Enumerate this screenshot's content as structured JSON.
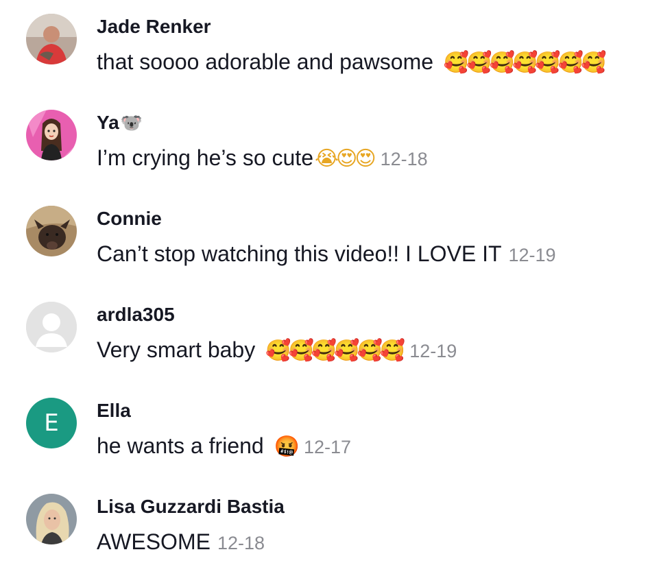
{
  "comments": [
    {
      "username": "Jade Renker",
      "name_emoji": "",
      "text": "that soooo adorable and pawsome",
      "emojis": "🥰🥰🥰🥰🥰🥰🥰",
      "date": "",
      "avatar": "photo-woman-red-shirt"
    },
    {
      "username": "Ya",
      "name_emoji": "🐨",
      "text": "I’m crying he’s so cute",
      "emojis": "😭😍😍",
      "date": "12-18",
      "avatar": "cartoon-girl-pink-background"
    },
    {
      "username": "Connie",
      "name_emoji": "",
      "text": "Can’t stop watching this video!! I LOVE IT",
      "emojis": "",
      "date": "12-19",
      "avatar": "photo-dog"
    },
    {
      "username": "ardla305",
      "name_emoji": "",
      "text": "Very smart baby",
      "emojis": "🥰🥰🥰🥰🥰🥰",
      "date": "12-19",
      "avatar": "default-user-silhouette"
    },
    {
      "username": "Ella",
      "name_emoji": "",
      "text": "he wants a friend",
      "emojis": "🤬",
      "date": "12-17",
      "avatar": "initial-E",
      "avatar_initial": "E"
    },
    {
      "username": "Lisa Guzzardi Bastia",
      "name_emoji": "",
      "text": "AWESOME",
      "emojis": "",
      "date": "12-18",
      "avatar": "photo-blonde-woman"
    }
  ],
  "colors": {
    "text": "#161823",
    "date": "#8a8b91",
    "initial_avatar_bg": "#1a9a82",
    "default_avatar_bg": "#e3e3e3"
  }
}
